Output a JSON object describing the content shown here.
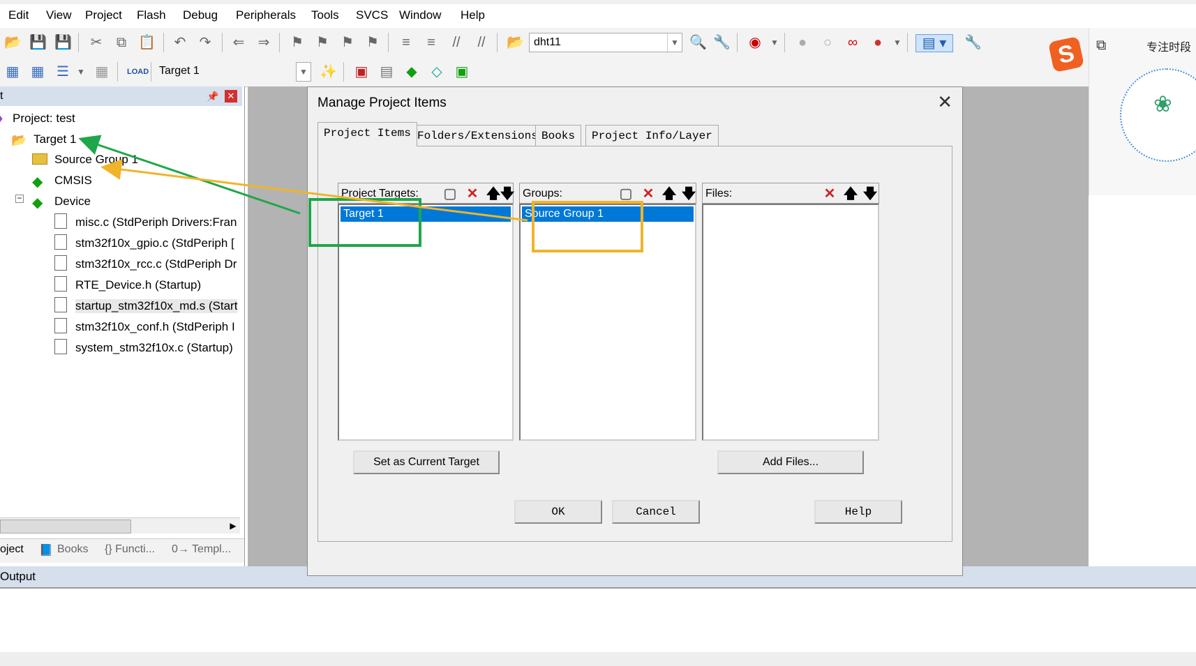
{
  "menu": [
    "Edit",
    "View",
    "Project",
    "Flash",
    "Debug",
    "Peripherals",
    "Tools",
    "SVCS",
    "Window",
    "Help"
  ],
  "toolbar": {
    "target_combo": "dht11",
    "target_select": "Target 1"
  },
  "project_panel": {
    "header": "t",
    "root": "Project: test",
    "target": "Target 1",
    "items": [
      {
        "label": "Source Group 1",
        "icon": "folder-icon"
      },
      {
        "label": "CMSIS",
        "icon": "diamond-icon"
      },
      {
        "label": "Device",
        "icon": "diamond-icon"
      },
      {
        "label": "misc.c (StdPeriph Drivers:Fran",
        "icon": "file-key-icon"
      },
      {
        "label": "stm32f10x_gpio.c (StdPeriph [",
        "icon": "file-key-icon"
      },
      {
        "label": "stm32f10x_rcc.c (StdPeriph Dr",
        "icon": "file-key-icon"
      },
      {
        "label": "RTE_Device.h (Startup)",
        "icon": "file-icon"
      },
      {
        "label": "startup_stm32f10x_md.s (Start",
        "icon": "file-icon"
      },
      {
        "label": "stm32f10x_conf.h (StdPeriph I",
        "icon": "file-icon"
      },
      {
        "label": "system_stm32f10x.c (Startup)",
        "icon": "file-icon"
      }
    ],
    "tabs": [
      "oject",
      "Books",
      "{} Functi...",
      "0→ Templ..."
    ]
  },
  "output_label": "Output",
  "dialog": {
    "title": "Manage Project Items",
    "tabs": [
      "Project Items",
      "Folders/Extensions",
      "Books",
      "Project Info/Layer"
    ],
    "targets_header": "Project Targets:",
    "groups_header": "Groups:",
    "files_header": "Files:",
    "targets": [
      "Target 1"
    ],
    "groups": [
      "Source Group 1"
    ],
    "set_current_label": "Set as Current Target",
    "add_files_label": "Add Files...",
    "ok_label": "OK",
    "cancel_label": "Cancel",
    "help_label": "Help"
  },
  "widget": {
    "title": "专注时段"
  },
  "colors": {
    "selection": "#0078d7",
    "annot_green": "#1fa64a",
    "annot_yellow": "#f0b429"
  }
}
